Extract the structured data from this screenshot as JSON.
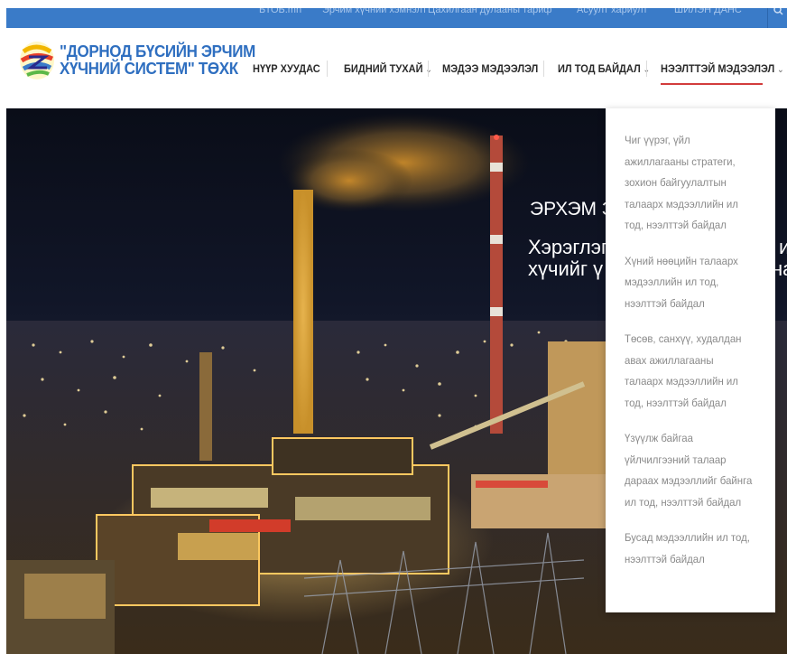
{
  "topbar": {
    "links": [
      "БТОБ.mn",
      "Эрчим хүчний хэмнэлт",
      "Цахилгаан дулааны тариф",
      "Асуулт хариулт",
      "ШИЛЭН ДАНС"
    ]
  },
  "brand": {
    "line1": "\"ДОРНОД БҮСИЙН ЭРЧИМ",
    "line2": "ХҮЧНИЙ СИСТЕМ\" ТӨХК"
  },
  "nav": {
    "items": [
      {
        "label": "НҮҮР ХУУДАС",
        "has_dropdown": false
      },
      {
        "label": "БИДНИЙ ТУХАЙ",
        "has_dropdown": true
      },
      {
        "label": "МЭДЭЭ МЭДЭЭЛЭЛ",
        "has_dropdown": false
      },
      {
        "label": "ИЛ ТОД БАЙДАЛ",
        "has_dropdown": true
      },
      {
        "label": "НЭЭЛТТЭЙ МЭДЭЭЛЭЛ",
        "has_dropdown": true
      }
    ],
    "active_index": 4,
    "chevron": "⌄"
  },
  "hero": {
    "title": "ЭРХЭМ З",
    "subtitle_line1": "Хэрэглэг",
    "subtitle_line2": "хүчийг ү",
    "subtitle_right1": "и",
    "subtitle_right2": "на"
  },
  "dropdown": {
    "items": [
      "Чиг үүрэг, үйл ажиллагааны стратеги, зохион байгуулалтын талаарх мэдээллийн ил тод, нээлттэй байдал",
      "Хүний нөөцийн талаарх мэдээллийн ил тод, нээлттэй байдал",
      "Төсөв, санхүү, худалдан авах ажиллагааны талаарх мэдээллийн ил тод, нээлттэй байдал",
      "Үзүүлж байгаа үйлчилгээний талаар дараах мэдээллийг байнга ил тод, нээлттэй байдал",
      "Бусад мэдээллийн ил тод, нээлттэй байдал"
    ]
  },
  "colors": {
    "topbar": "#3a7bc8",
    "brand": "#2f6fc0",
    "active_underline": "#d23c3c"
  },
  "icons": {
    "search": "search-icon",
    "logo": "logo-icon"
  }
}
